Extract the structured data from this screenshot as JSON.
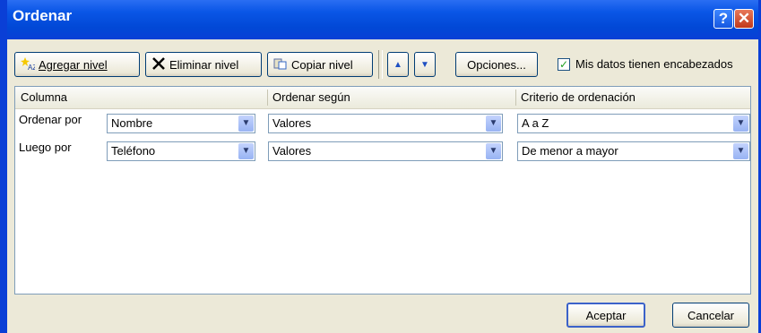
{
  "window": {
    "title": "Ordenar",
    "help_glyph": "?",
    "close_glyph": "✕"
  },
  "toolbar": {
    "add_level": "Agregar nivel",
    "delete_level": "Eliminar nivel",
    "copy_level": "Copiar nivel",
    "move_up": "▲",
    "move_down": "▼",
    "options": "Opciones...",
    "header_checkbox": {
      "label": "Mis datos tienen encabezados",
      "checked": true
    }
  },
  "grid": {
    "headers": [
      "Columna",
      "Ordenar según",
      "Criterio de ordenación"
    ],
    "rows": [
      {
        "label": "Ordenar por",
        "column": "Nombre",
        "sort_on": "Valores",
        "order": "A a Z"
      },
      {
        "label": "Luego por",
        "column": "Teléfono",
        "sort_on": "Valores",
        "order": "De menor a mayor"
      }
    ]
  },
  "footer": {
    "ok": "Aceptar",
    "cancel": "Cancelar"
  },
  "colors": {
    "titlebar": "#0148d6",
    "dialog_bg": "#ece9d8",
    "border": "#7f9db9"
  }
}
